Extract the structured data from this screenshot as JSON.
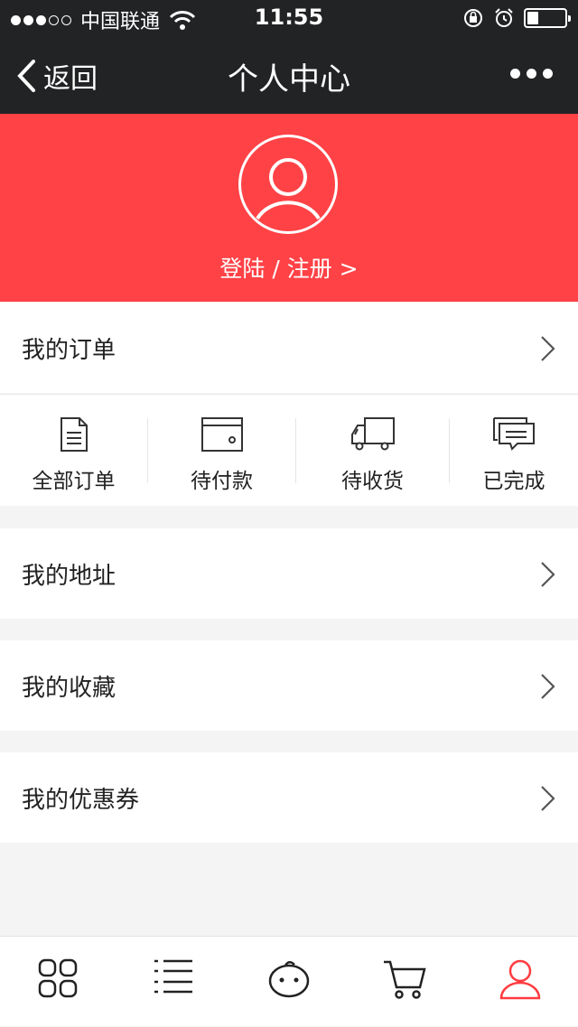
{
  "status_bar": {
    "carrier": "中国联通",
    "time": "11:55"
  },
  "nav": {
    "back_label": "返回",
    "title": "个人中心"
  },
  "profile": {
    "login_label": "登陆 / 注册 >"
  },
  "orders": {
    "header": "我的订单",
    "tabs": [
      {
        "label": "全部订单",
        "icon": "document-icon"
      },
      {
        "label": "待付款",
        "icon": "wallet-icon"
      },
      {
        "label": "待收货",
        "icon": "truck-icon"
      },
      {
        "label": "已完成",
        "icon": "chat-icon"
      }
    ]
  },
  "menu": [
    {
      "label": "我的地址"
    },
    {
      "label": "我的收藏"
    },
    {
      "label": "我的优惠券"
    }
  ],
  "tab_bar": {
    "items": [
      "grid-icon",
      "list-icon",
      "mascot-icon",
      "cart-icon",
      "user-icon"
    ],
    "active_index": 4,
    "active_color": "#ff3b3f",
    "inactive_color": "#222222"
  },
  "colors": {
    "header_bg": "#222325",
    "banner_bg": "#ff4246"
  }
}
